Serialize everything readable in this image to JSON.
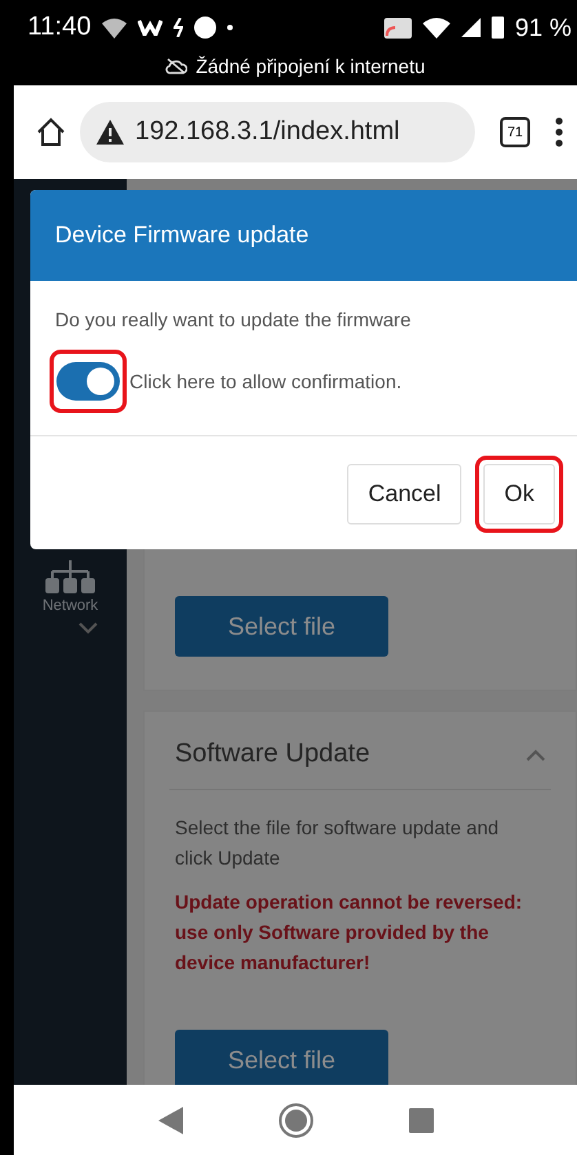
{
  "status_bar": {
    "time": "11:40",
    "battery": "91 %",
    "notice": "Žádné připojení k internetu"
  },
  "browser": {
    "url": "192.168.3.1/index.html",
    "tab_count": "71"
  },
  "sidebar": {
    "items": [
      {
        "label": "Network",
        "expanded": false
      }
    ]
  },
  "cards": [
    {
      "kind": "upload",
      "button": "Select file"
    },
    {
      "kind": "section",
      "title": "Software Update",
      "expanded": true,
      "description": "Select the file for software update and click Update",
      "warning": "Update operation cannot be reversed: use only Software provided by the device manufacturer!",
      "button": "Select file"
    }
  ],
  "dialog": {
    "title": "Device Firmware update",
    "message": "Do you really want to update the firmware",
    "toggle": {
      "label": "Click here to allow confirmation.",
      "on": true,
      "highlighted": true
    },
    "buttons": [
      {
        "label": "Cancel",
        "highlighted": false
      },
      {
        "label": "Ok",
        "highlighted": true
      }
    ]
  }
}
